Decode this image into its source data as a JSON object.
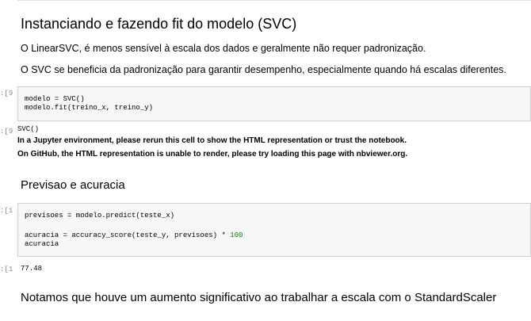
{
  "sections": {
    "svc_heading": "Instanciando e fazendo fit do modelo (SVC)",
    "svc_p1": "O LinearSVC, é menos sensível à escala dos dados e geralmente não requer padronização.",
    "svc_p2": "O SVC se beneficia da padronização para garantir desempenho, especialmente quando há escalas diferentes.",
    "prev_heading": "Previsao e acuracia",
    "conclusion_heading": "Notamos que houve um aumento significativo ao trabalhar a escala com o StandardScaler"
  },
  "cell1": {
    "in_prompt": "9]:",
    "code_line1": "modelo = SVC()",
    "code_line2": "modelo.fit(treino_x, treino_y)",
    "out_prompt": "9]:",
    "out_repr": "SVC()",
    "out_note1": "In a Jupyter environment, please rerun this cell to show the HTML representation or trust the notebook.",
    "out_note2": "On GitHub, the HTML representation is unable to render, please try loading this page with nbviewer.org."
  },
  "cell2": {
    "in_prompt": "1]:",
    "code_line1": "previsoes = modelo.predict(teste_x)",
    "code_line3a": "acuracia = accuracy_score(teste_y, previsoes) * ",
    "code_line3b": "100",
    "code_line4": "acuracia",
    "out_prompt": "1]:",
    "out_value": "77.48"
  }
}
